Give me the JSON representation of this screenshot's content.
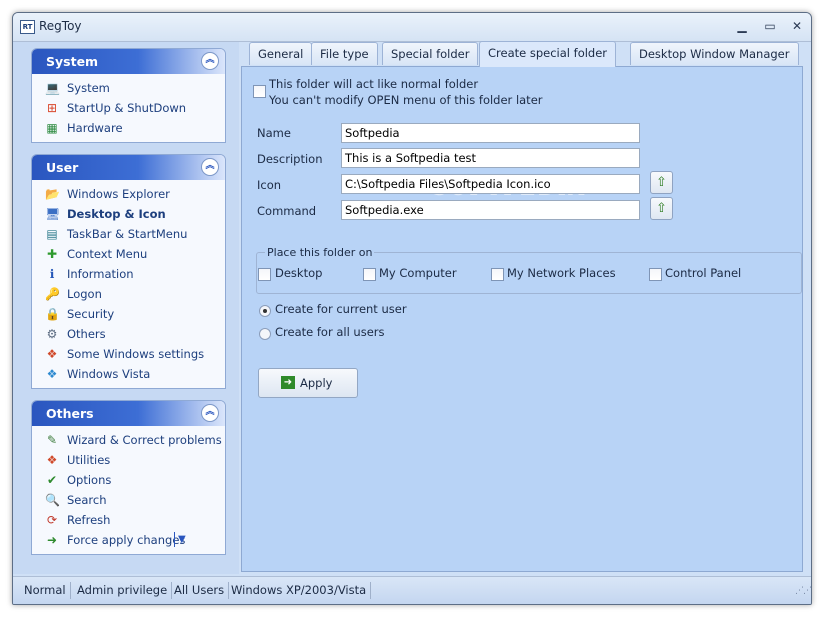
{
  "window": {
    "title": "RegToy",
    "app_icon_text": "RT"
  },
  "groups": [
    {
      "title": "System",
      "items": [
        {
          "label": "System",
          "icon": "computer-icon",
          "glyph": "💻",
          "color": "#4a6fa8"
        },
        {
          "label": "StartUp & ShutDown",
          "icon": "windows-flag-icon",
          "glyph": "⊞",
          "color": "#d9472b"
        },
        {
          "label": "Hardware",
          "icon": "circuit-board-icon",
          "glyph": "▦",
          "color": "#2b8a3e"
        }
      ]
    },
    {
      "title": "User",
      "items": [
        {
          "label": "Windows Explorer",
          "icon": "folder-explorer-icon",
          "glyph": "📂",
          "color": "#d9a52b"
        },
        {
          "label": "Desktop & Icon",
          "icon": "desktop-icon",
          "glyph": "🖥",
          "color": "#3b6fc4",
          "active": true
        },
        {
          "label": "TaskBar & StartMenu",
          "icon": "taskbar-icon",
          "glyph": "▤",
          "color": "#2b7a8a"
        },
        {
          "label": "Context Menu",
          "icon": "plus-icon",
          "glyph": "✚",
          "color": "#2e9a2e"
        },
        {
          "label": "Information",
          "icon": "info-icon",
          "glyph": "ℹ",
          "color": "#2456b8"
        },
        {
          "label": "Logon",
          "icon": "key-icon",
          "glyph": "🔑",
          "color": "#c08a1a"
        },
        {
          "label": "Security",
          "icon": "lock-icon",
          "glyph": "🔒",
          "color": "#b8921a"
        },
        {
          "label": "Others",
          "icon": "gear-icon",
          "glyph": "⚙",
          "color": "#5a6a80"
        },
        {
          "label": "Some Windows settings",
          "icon": "windows-logo-icon",
          "glyph": "❖",
          "color": "#d04a2b"
        },
        {
          "label": "Windows Vista",
          "icon": "windows-vista-icon",
          "glyph": "❖",
          "color": "#2e8ad0"
        }
      ]
    },
    {
      "title": "Others",
      "items": [
        {
          "label": "Wizard & Correct problems",
          "icon": "wizard-icon",
          "glyph": "✎",
          "color": "#3a7a3a"
        },
        {
          "label": "Utilities",
          "icon": "utilities-icon",
          "glyph": "❖",
          "color": "#d04a2b"
        },
        {
          "label": "Options",
          "icon": "options-icon",
          "glyph": "✔",
          "color": "#2e8a2e"
        },
        {
          "label": "Search",
          "icon": "search-icon",
          "glyph": "🔍",
          "color": "#4a6fa8"
        },
        {
          "label": "Refresh",
          "icon": "refresh-icon",
          "glyph": "⟳",
          "color": "#c0392b"
        },
        {
          "label": "Force apply changes",
          "icon": "force-apply-icon",
          "glyph": "➜",
          "color": "#2e8a2e",
          "dropdown": "▼"
        }
      ]
    }
  ],
  "tabs": [
    {
      "label": "General"
    },
    {
      "label": "File type"
    },
    {
      "label": "Special folder"
    },
    {
      "label": "Create special folder",
      "active": true
    },
    {
      "label": "Desktop Window Manager"
    }
  ],
  "form": {
    "normal_folder_line1": "This folder will act like normal folder",
    "normal_folder_line2": "You can't modify OPEN menu of this folder later",
    "name_label": "Name",
    "name_value": "Softpedia",
    "description_label": "Description",
    "description_value": "This is a Softpedia test",
    "icon_label": "Icon",
    "icon_value": "C:\\Softpedia Files\\Softpedia Icon.ico",
    "command_label": "Command",
    "command_value": "Softpedia.exe",
    "place_legend": "Place this folder on",
    "places": [
      "Desktop",
      "My Computer",
      "My Network Places",
      "Control Panel"
    ],
    "radio_current": "Create for current user",
    "radio_all": "Create for all users",
    "apply_label": "Apply"
  },
  "watermark": "SOFTPEDIA",
  "statusbar": [
    "Normal",
    "Admin privilege",
    "All Users",
    "Windows XP/2003/Vista"
  ]
}
